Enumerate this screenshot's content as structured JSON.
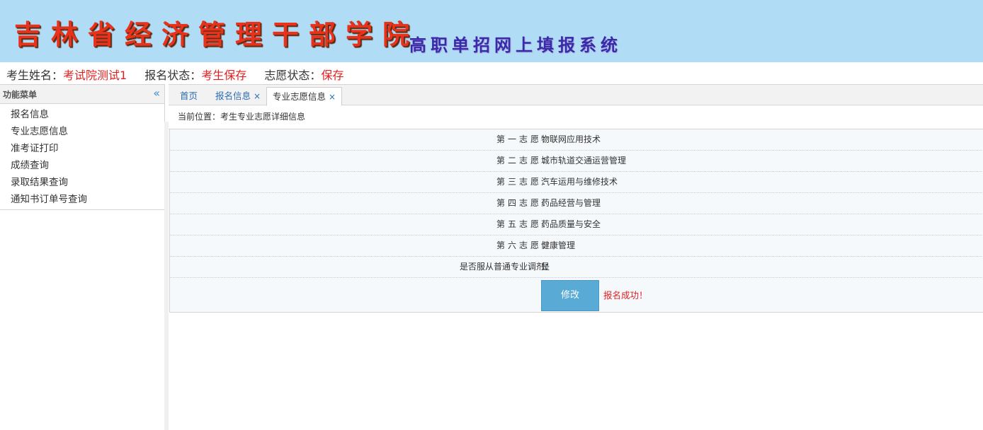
{
  "banner": {
    "school_name": "吉林省经济管理干部学院",
    "system_name": "高职单招网上填报系统"
  },
  "status_bar": {
    "name_label": "考生姓名：",
    "name_value": "考试院测试1",
    "reg_label": "报名状态：",
    "reg_value": "考生保存",
    "pref_label": "志愿状态：",
    "pref_value": "保存"
  },
  "sidebar": {
    "title": "功能菜单",
    "collapse_icon": "«",
    "items": [
      {
        "label": "报名信息"
      },
      {
        "label": "专业志愿信息"
      },
      {
        "label": "准考证打印"
      },
      {
        "label": "成绩查询"
      },
      {
        "label": "录取结果查询"
      },
      {
        "label": "通知书订单号查询"
      }
    ]
  },
  "tabs": [
    {
      "label": "首页",
      "closable": false
    },
    {
      "label": "报名信息",
      "close": "×"
    },
    {
      "label": "专业志愿信息",
      "close": "×",
      "active": true
    }
  ],
  "breadcrumb": "当前位置：考生专业志愿详细信息",
  "preferences": [
    {
      "label": "第一志愿：",
      "value": "物联网应用技术"
    },
    {
      "label": "第二志愿：",
      "value": "城市轨道交通运营管理"
    },
    {
      "label": "第三志愿：",
      "value": "汽车运用与维修技术"
    },
    {
      "label": "第四志愿：",
      "value": "药品经营与管理"
    },
    {
      "label": "第五志愿：",
      "value": "药品质量与安全"
    },
    {
      "label": "第六志愿：",
      "value": "健康管理"
    }
  ],
  "adjust": {
    "label": "是否服从普通专业调剂：",
    "value": "是"
  },
  "actions": {
    "edit_button": "修改",
    "success_message": "报名成功！"
  },
  "colors": {
    "banner_bg": "#b0dcf6",
    "accent_red": "#e02020",
    "button_blue": "#5aaad6",
    "link_blue": "#2c6cb3"
  }
}
